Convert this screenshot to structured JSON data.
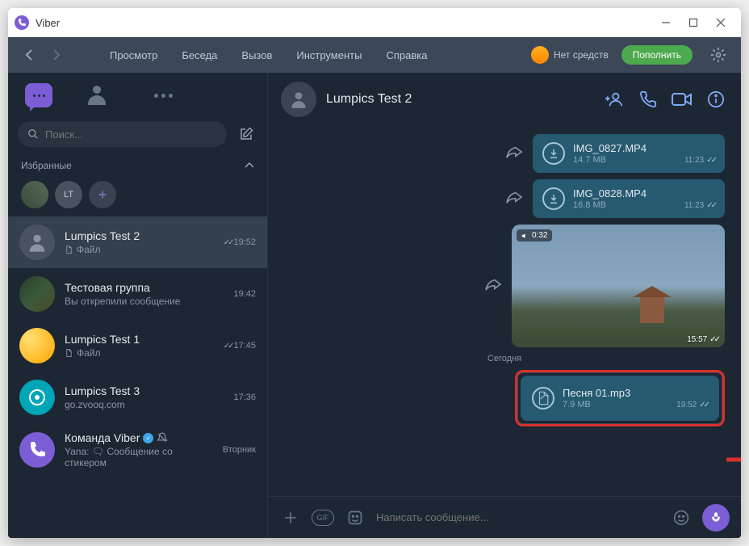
{
  "window": {
    "title": "Viber"
  },
  "menu": {
    "view": "Просмотр",
    "chat": "Беседа",
    "call": "Вызов",
    "tools": "Инструменты",
    "help": "Справка",
    "balance_label": "Нет средств",
    "topup": "Пополнить"
  },
  "sidebar": {
    "search_placeholder": "Поиск...",
    "favorites_label": "Избранные",
    "fav_lt": "LT",
    "chats": [
      {
        "name": "Lumpics Test 2",
        "preview": "Файл",
        "time": "19:52",
        "read": true
      },
      {
        "name": "Тестовая группа",
        "preview": "Вы открепили сообщение",
        "time": "19:42"
      },
      {
        "name": "Lumpics Test 1",
        "preview": "Файл",
        "time": "17:45",
        "read": true
      },
      {
        "name": "Lumpics Test 3",
        "preview": "go.zvooq.com",
        "time": "17:36"
      },
      {
        "name": "Команда Viber",
        "preview": "Yana: 🗨 Сообщение со стикером",
        "time": "Вторник"
      }
    ]
  },
  "chat": {
    "contact": "Lumpics Test 2",
    "files": [
      {
        "name": "IMG_0827.MP4",
        "size": "14.7 MB",
        "time": "11:23"
      },
      {
        "name": "IMG_0828.MP4",
        "size": "16.8 MB",
        "time": "11:23"
      }
    ],
    "video": {
      "duration": "0:32",
      "time": "15:57"
    },
    "today": "Сегодня",
    "audio": {
      "name": "Песня 01.mp3",
      "size": "7.9 MB",
      "time": "19:52"
    },
    "input_placeholder": "Написать сообщение...",
    "gif_label": "GIF"
  }
}
